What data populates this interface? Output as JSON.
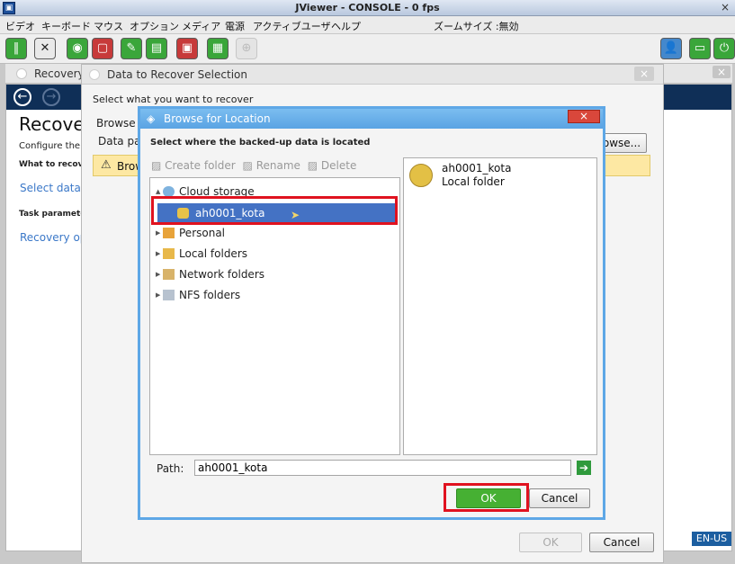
{
  "window": {
    "title": "JViewer - CONSOLE - 0 fps",
    "close": "×"
  },
  "menu": {
    "items": [
      "ビデオ",
      "キーボード",
      "マウス",
      "オプション",
      "メディア",
      "電源",
      "アクティブユーザ",
      "ヘルプ"
    ],
    "zoom_label": "ズームサイズ :無効"
  },
  "toolbar": {
    "icons": [
      "pause-icon",
      "keyboard-icon",
      "cd-icon",
      "floppy-icon",
      "usb-icon",
      "hdd-icon",
      "record-icon",
      "chip-icon",
      "zoom-icon",
      "user-icon",
      "monitor-icon",
      "power-icon"
    ]
  },
  "recovery_window": {
    "tab_label": "Recovery",
    "heading": "Recove",
    "configure_text": "Configure the re",
    "what_to_recover": "What to recover",
    "select_data_link": "Select data.",
    "task_parameters": "Task parameters",
    "recovery_options_link": "Recovery op"
  },
  "data_dialog": {
    "title": "Data to Recover Selection",
    "prompt": "Select what you want to recover",
    "browse_label": "Browse",
    "data_path_label": "Data pa",
    "browse_button": "owse...",
    "warning_text": "Brow",
    "ok_button": "OK",
    "cancel_button": "Cancel",
    "close": "×"
  },
  "browse_dialog": {
    "title": "Browse for Location",
    "close": "×",
    "instruction": "Select where the backed-up data is located",
    "actions": {
      "create_folder": "Create folder",
      "rename": "Rename",
      "delete": "Delete"
    },
    "tree": [
      {
        "label": "Cloud storage",
        "icon": "cloud-icon",
        "expanded": true
      },
      {
        "label": "ah0001_kota",
        "icon": "cloud-user-icon",
        "selected": true
      },
      {
        "label": "Personal",
        "icon": "personal-folder-icon"
      },
      {
        "label": "Local folders",
        "icon": "local-folder-icon"
      },
      {
        "label": "Network folders",
        "icon": "network-folder-icon"
      },
      {
        "label": "NFS folders",
        "icon": "nfs-folder-icon"
      }
    ],
    "detail": {
      "name": "ah0001_kota",
      "type": "Local folder"
    },
    "path_label": "Path:",
    "path_value": "ah0001_kota",
    "ok_button": "OK",
    "cancel_button": "Cancel"
  },
  "status": {
    "locale": "EN-US"
  }
}
